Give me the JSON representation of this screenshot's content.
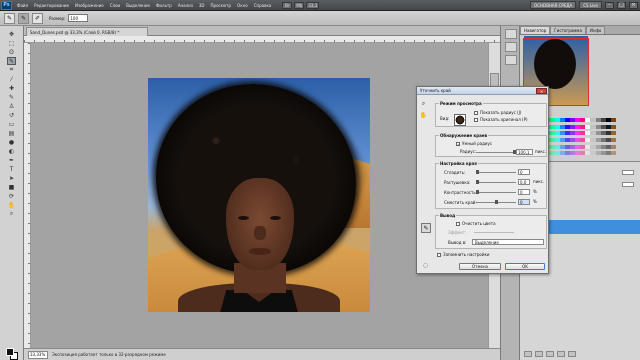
{
  "menubar": {
    "logo": "Ps",
    "items": [
      "Файл",
      "Редактирование",
      "Изображение",
      "Слои",
      "Выделение",
      "Фильтр",
      "Анализ",
      "3D",
      "Просмотр",
      "Окно",
      "Справка"
    ],
    "zoom": "33,3",
    "workspace": "ОСНОВНАЯ СРЕДА",
    "cs_live": "CS Live"
  },
  "options": {
    "size_label": "Размер:",
    "size_value": "100"
  },
  "document": {
    "tab_title": "Sand_Dunes.psd @ 33,3% (Слой 0, RGB/8) *",
    "zoom": "33,33%",
    "status": "Экспозиция работает только в 32-разрядном режиме"
  },
  "dialog": {
    "title": "Уточнить край",
    "close": "×",
    "view_mode": {
      "title": "Режим просмотра",
      "view_label": "Вид:",
      "show_radius": "Показать радиус (J)",
      "show_original": "Показать оригинал (P)"
    },
    "edge_detection": {
      "title": "Обнаружение краев",
      "smart_radius": "Умный радиус",
      "radius_label": "Радиус:",
      "radius_value": "100,1",
      "radius_unit": "пикс."
    },
    "adjust_edge": {
      "title": "Настройка края",
      "rows": [
        {
          "label": "Сгладить:",
          "value": "0",
          "unit": ""
        },
        {
          "label": "Растушевка:",
          "value": "0,0",
          "unit": "пикс."
        },
        {
          "label": "Контрастность:",
          "value": "0",
          "unit": "%"
        },
        {
          "label": "Сместить край:",
          "value": "0",
          "unit": "%"
        }
      ]
    },
    "output": {
      "title": "Вывод",
      "decontaminate": "Очистить цвета",
      "amount_label": "Эффект:",
      "output_to_label": "Вывод в:",
      "output_to_value": "Выделение"
    },
    "remember": "Запомнить настройки",
    "cancel": "Отмена",
    "ok": "OK"
  },
  "panels": {
    "tabs": [
      "Навигатор",
      "Гистограмма",
      "Инфо"
    ],
    "colors": [
      "#ff0000",
      "#ff8000",
      "#ffff00",
      "#80ff00",
      "#00ff00",
      "#00ff80",
      "#00ffff",
      "#0080ff",
      "#0000ff",
      "#8000ff",
      "#ff00ff",
      "#ff0080",
      "#ffffff",
      "#c0c0c0",
      "#808080",
      "#404040",
      "#000000",
      "#804000"
    ]
  }
}
